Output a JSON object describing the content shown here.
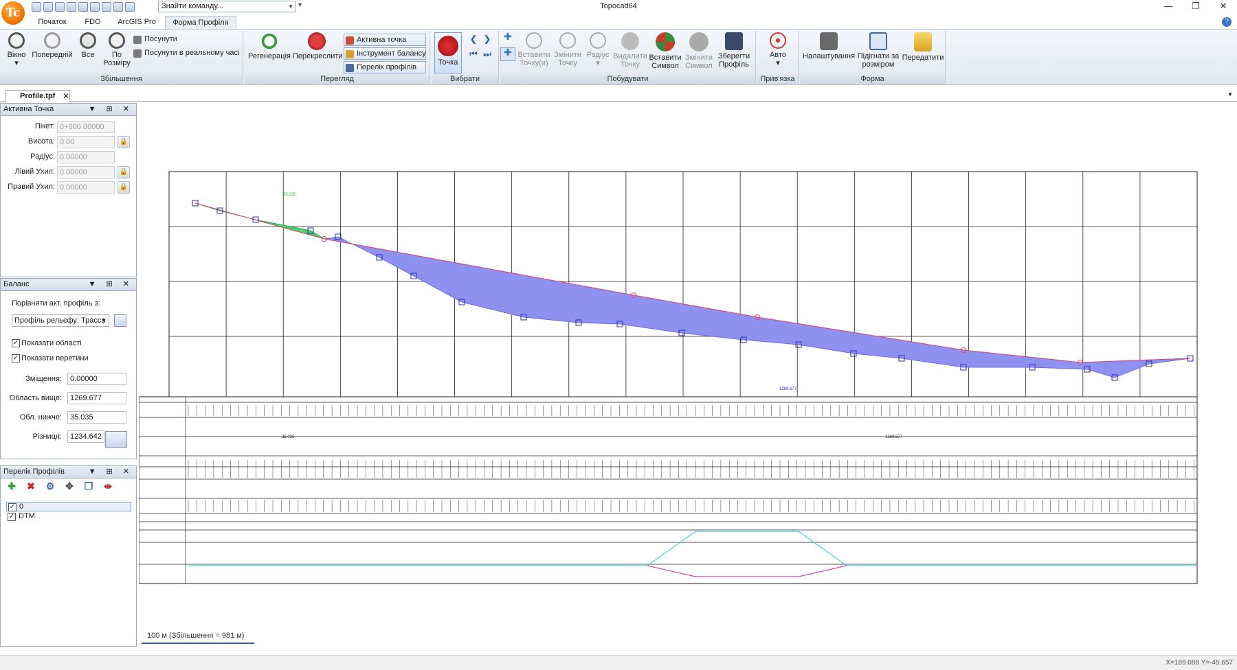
{
  "app": {
    "title": "Topocad64",
    "logo_text": "Tc"
  },
  "command_search": {
    "placeholder": "Знайти команду..."
  },
  "ribbon_tabs": [
    "Початок",
    "FDO",
    "ArcGIS Pro",
    "Форма Профіля"
  ],
  "active_tab_index": 3,
  "groups": {
    "zoom": {
      "label": "Збільшення",
      "window": "Вікно",
      "previous": "Попередній",
      "all": "Все",
      "by_size": "По\nРозміру",
      "move": "Посунути",
      "move_realtime": "Посунути в реальному часі"
    },
    "view": {
      "label": "Перегляд",
      "regen": "Регенерація",
      "redraw": "Перекреслити",
      "active_point": "Активна точка",
      "balance_tool": "Інструмент балансу",
      "profile_list": "Перелік профілів"
    },
    "select": {
      "label": "Вибрати",
      "point": "Точка"
    },
    "build": {
      "label": "Побудувати",
      "insert_points": "Вставити\nТочку(и)",
      "change_point": "Змінити\nТочку",
      "radius": "Радіус",
      "delete_point": "Видалити\nТочку",
      "insert_symbol": "Вставити\nСимвол",
      "change_symbol": "Змінити\nСимвол",
      "save_profile": "Зберегти\nПрофіль"
    },
    "snap": {
      "label": "Прив'язка",
      "auto": "Авто"
    },
    "form": {
      "label": "Форма",
      "settings": "Налаштування",
      "fit": "Підігнати за\nрозміром",
      "send": "Передатити"
    }
  },
  "document_tab": "Profile.tpf",
  "active_point_panel": {
    "title": "Активна Точка",
    "fields": [
      {
        "label": "Пікет:",
        "value": "0+000.00000",
        "lock": false
      },
      {
        "label": "Висота:",
        "value": "0.00",
        "lock": true
      },
      {
        "label": "Радіус:",
        "value": "0.00000",
        "lock": false
      },
      {
        "label": "Лівий Ухил:",
        "value": "0.00000",
        "lock": true
      },
      {
        "label": "Правий Ухил:",
        "value": "0.00000",
        "lock": true
      }
    ]
  },
  "balance_panel": {
    "title": "Баланс",
    "compare_label": "Порівняти акт. профіль з:",
    "compare_value": "Профіль рельєфу: Трасса",
    "show_areas": "Показати області",
    "show_intersections": "Показати перетини",
    "offset_label": "Зміщення:",
    "offset_value": "0.00000",
    "area_above_label": "Область вище:",
    "area_above_value": "1269.677",
    "area_below_label": "Обл. нижче:",
    "area_below_value": "35.035",
    "diff_label": "Різниця:",
    "diff_value": "1234.642"
  },
  "profile_list_panel": {
    "title": "Перелік Профілів",
    "items": [
      {
        "name": "0",
        "checked": true
      },
      {
        "name": "DTM",
        "checked": true
      }
    ]
  },
  "canvas": {
    "scale_label": "100 м (Збільшення = 981 м)",
    "annotations": {
      "left_fill": "35.035",
      "right_fill": "1269.677",
      "top_label": "-35.035"
    }
  },
  "status": {
    "coords": "X=189.088 Y=-45.657"
  },
  "colors": {
    "accent": "#f07800",
    "fill": "#8f91f0",
    "ribbon": "#e2e8f0"
  }
}
